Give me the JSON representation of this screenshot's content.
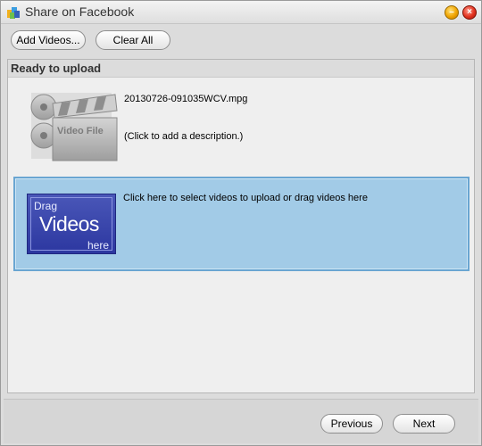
{
  "window": {
    "title": "Share on Facebook",
    "app_icon": "facebook-share-icon",
    "minimize_glyph": "–",
    "close_glyph": "×"
  },
  "toolbar": {
    "add_videos_label": "Add Videos...",
    "clear_all_label": "Clear All"
  },
  "panel": {
    "header": "Ready to upload",
    "items": [
      {
        "file_name": "20130726-091035WCV.mpg",
        "description_placeholder": "(Click to add a description.)",
        "thumbnail_label": "Video File",
        "thumbnail_icon": "video-file-icon"
      }
    ],
    "dropzone": {
      "instruction": "Click here to select videos to upload or drag videos here",
      "graphic_text": {
        "top": "Drag",
        "middle": "Videos",
        "bottom": "here"
      }
    }
  },
  "footer": {
    "previous_label": "Previous",
    "next_label": "Next"
  },
  "colors": {
    "dropzone_fill": "#a2cbe7",
    "dropzone_border": "#6aa6d2",
    "drag_graphic": "#3a46ab"
  }
}
